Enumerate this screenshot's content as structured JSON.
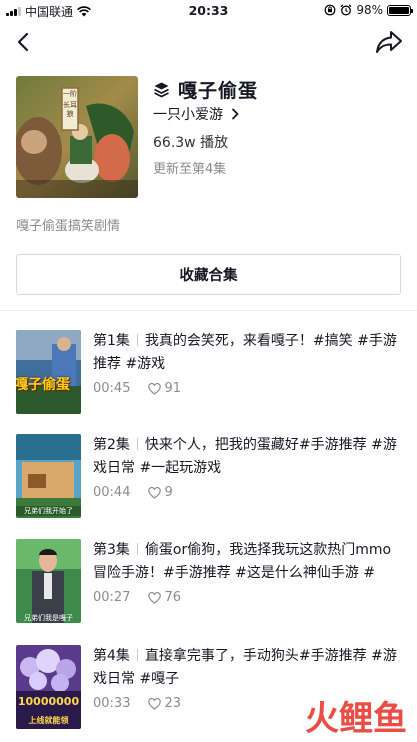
{
  "status_bar": {
    "carrier": "中国联通",
    "time": "20:33",
    "battery": "98%",
    "battery_level": 0.98
  },
  "nav": {
    "back_icon": "chevron-left-icon",
    "share_icon": "share-arrow-icon"
  },
  "collection": {
    "cover_label_1": "一阶",
    "cover_label_2": "长耳狼",
    "title": "嘎子偷蛋",
    "author": "一只小爱游",
    "plays": "66.3w 播放",
    "updated": "更新至第4集",
    "description": "嘎子偷蛋搞笑剧情",
    "collect_label": "收藏合集"
  },
  "episodes": [
    {
      "number": "第1集",
      "title": "我真的会笑死，来看嘎子！#搞笑 #手游推荐 #游戏",
      "duration": "00:45",
      "likes": "91",
      "thumb_text": "嘎子偷蛋"
    },
    {
      "number": "第2集",
      "title": "快来个人，把我的蛋藏好#手游推荐 #游戏日常 #一起玩游戏",
      "duration": "00:44",
      "likes": "9",
      "thumb_text": "兄弟们我开始了"
    },
    {
      "number": "第3集",
      "title": "偷蛋or偷狗，我选择我玩这款热门mmo冒险手游！#手游推荐 #这是什么神仙手游 #",
      "duration": "00:27",
      "likes": "76",
      "thumb_text": "兄弟们我是嘎子"
    },
    {
      "number": "第4集",
      "title": "直接拿完事了，手动狗头#手游推荐 #游戏日常 #嘎子",
      "duration": "00:33",
      "likes": "23",
      "thumb_text": "上线就能领",
      "thumb_number": "10000000"
    }
  ],
  "watermark": {
    "text": "火鲤鱼"
  },
  "colors": {
    "text_primary": "#161823",
    "text_secondary": "#8a8b91",
    "watermark": "#e8342c"
  }
}
